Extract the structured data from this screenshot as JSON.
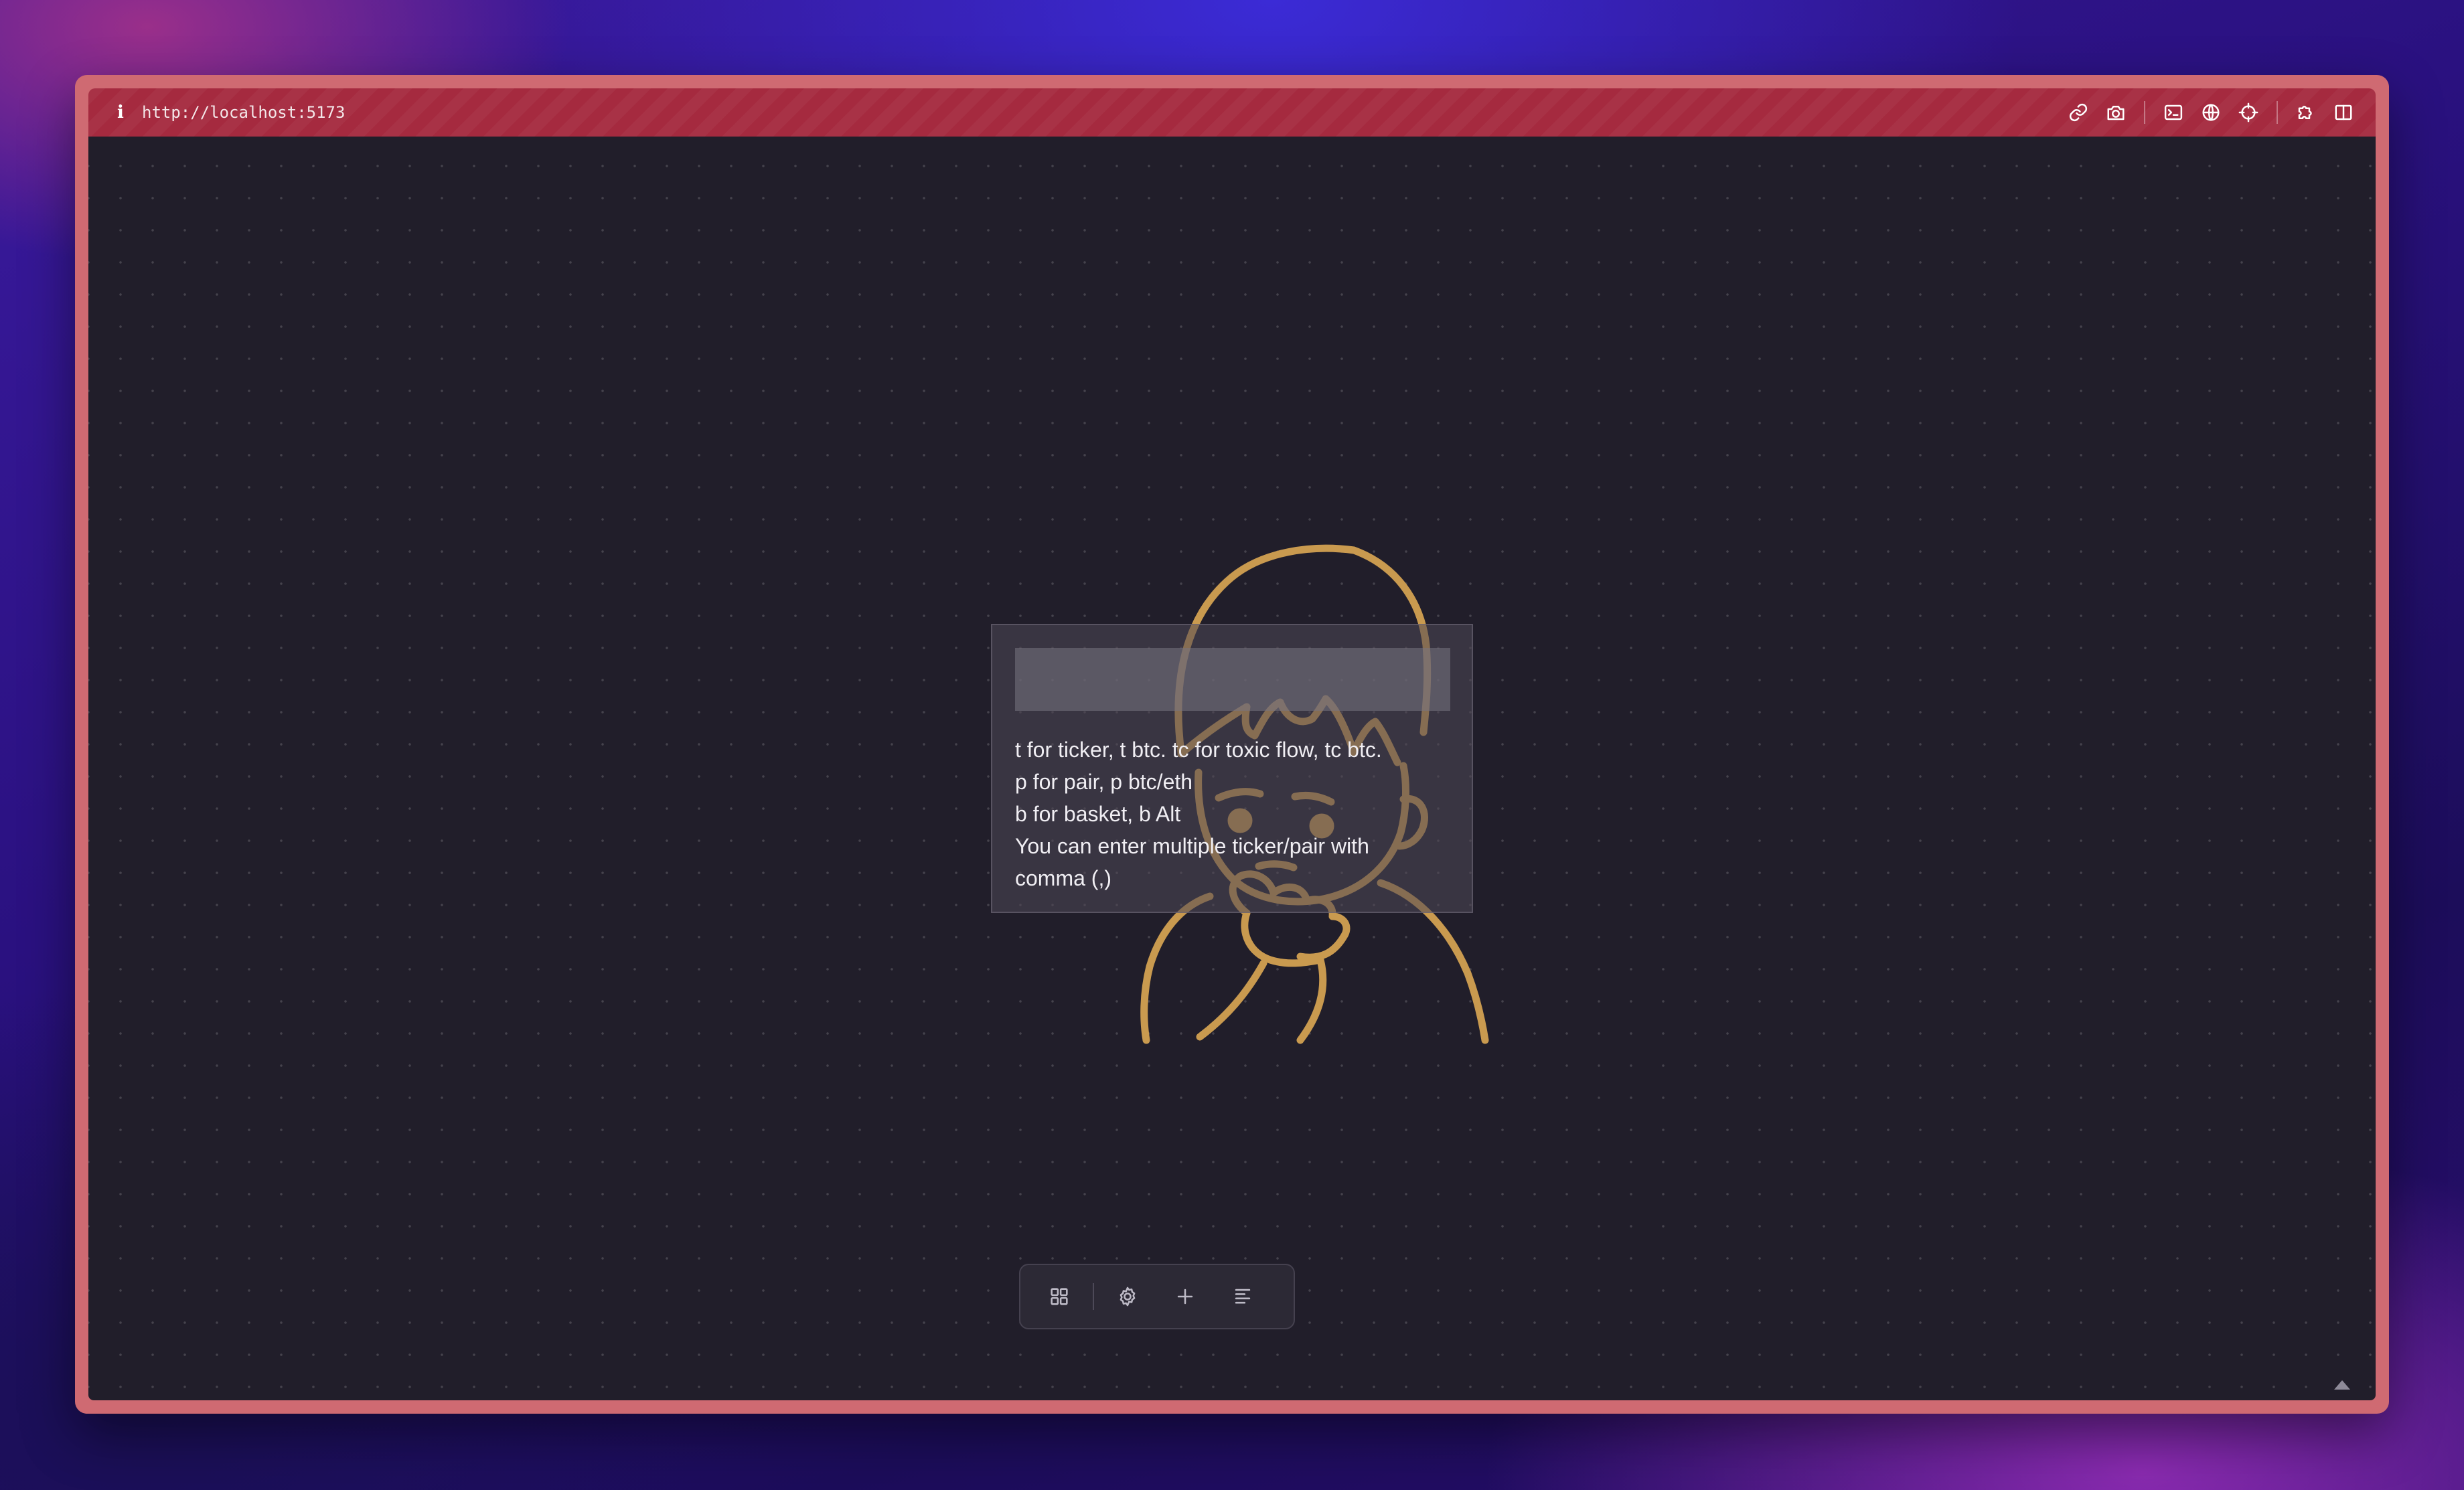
{
  "window": {
    "url": "http://localhost:5173",
    "info_glyph": "i",
    "toolbar_icons": [
      "link-icon",
      "camera-icon",
      "terminal-icon",
      "globe-icon",
      "crosshair-icon",
      "puzzle-icon",
      "split-view-icon"
    ]
  },
  "search": {
    "value": "",
    "placeholder": "",
    "hints": [
      "t for ticker, t btc. tc for toxic flow, tc btc.",
      "p for pair, p btc/eth",
      "b for basket, b Alt",
      "You can enter multiple ticker/pair with",
      "comma (,)"
    ]
  },
  "bottom_toolbar": {
    "icons": [
      "grid-icon",
      "gear-icon",
      "plus-icon",
      "align-left-icon"
    ]
  },
  "colors": {
    "window_frame": "#cf6a72",
    "titlebar": "#a52a3f",
    "canvas": "#211e2a",
    "illustration_stroke": "#c99a4f"
  }
}
